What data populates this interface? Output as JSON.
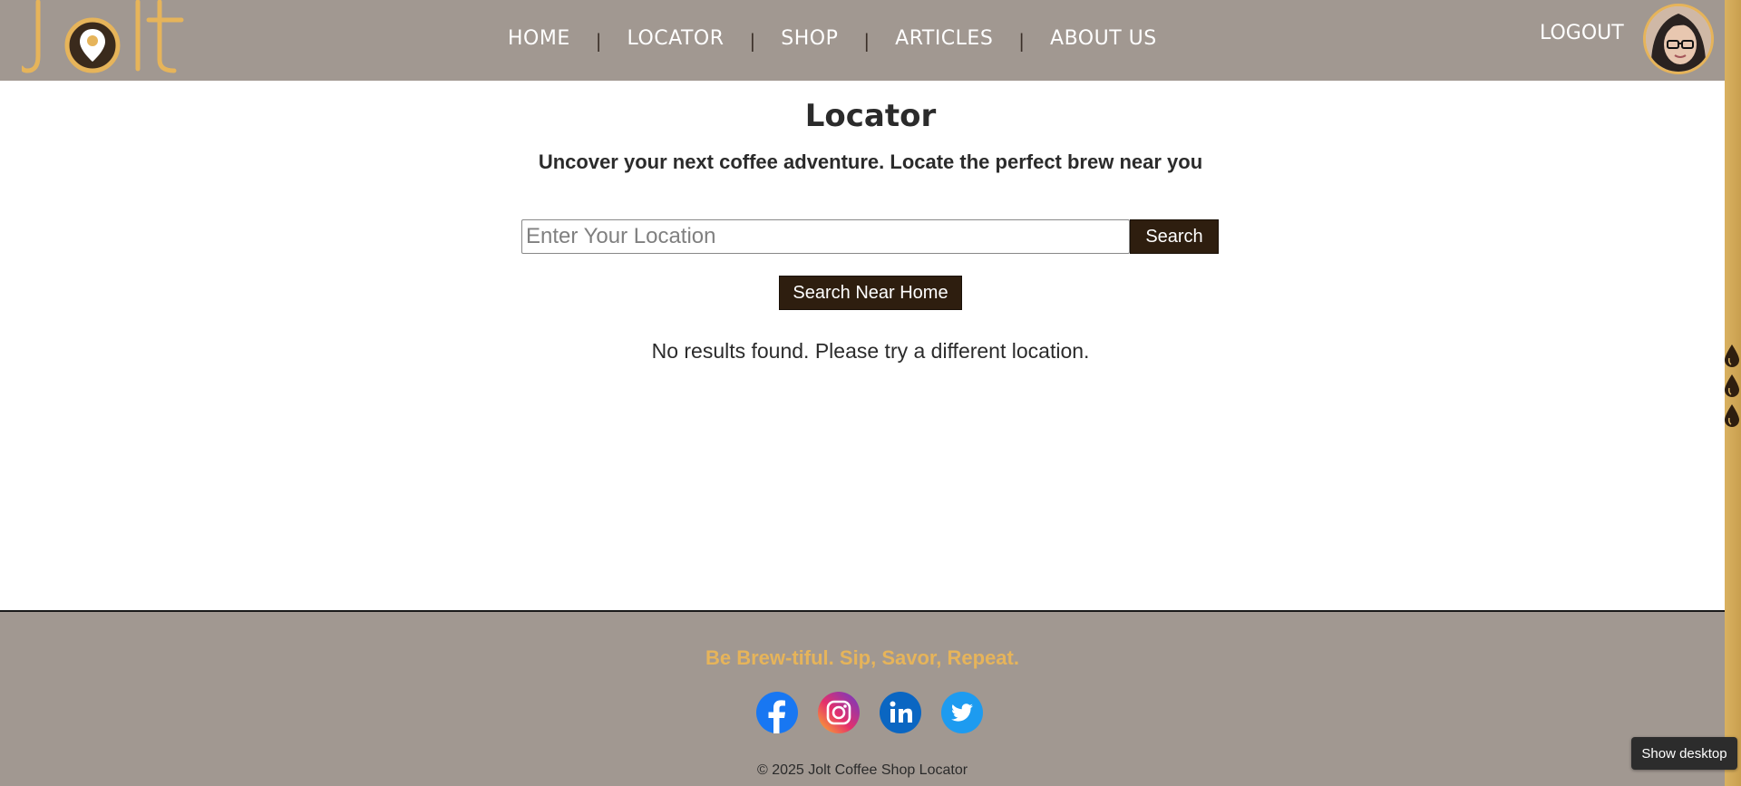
{
  "header": {
    "logo_text": "Jolt",
    "nav": [
      {
        "label": "HOME"
      },
      {
        "label": "LOCATOR"
      },
      {
        "label": "SHOP"
      },
      {
        "label": "ARTICLES"
      },
      {
        "label": "ABOUT US"
      }
    ],
    "nav_separator": "|",
    "logout_label": "LOGOUT"
  },
  "main": {
    "title": "Locator",
    "subtitle": "Uncover your next coffee adventure. Locate the perfect brew near you",
    "search": {
      "placeholder": "Enter Your Location",
      "value": "",
      "button_label": "Search"
    },
    "near_home_label": "Search Near Home",
    "no_results": "No results found. Please try a different location."
  },
  "footer": {
    "tagline": "Be Brew-tiful. Sip, Savor, Repeat.",
    "socials": [
      {
        "name": "facebook-icon"
      },
      {
        "name": "instagram-icon"
      },
      {
        "name": "linkedin-icon"
      },
      {
        "name": "twitter-icon"
      }
    ],
    "copyright": "© 2025 Jolt Coffee Shop Locator"
  },
  "system": {
    "show_desktop_label": "Show desktop"
  },
  "colors": {
    "header_bg": "#a19891",
    "accent_gold": "#e6b45a",
    "button_bg": "#2e1e0f",
    "text_dark": "#2b2b2b"
  }
}
